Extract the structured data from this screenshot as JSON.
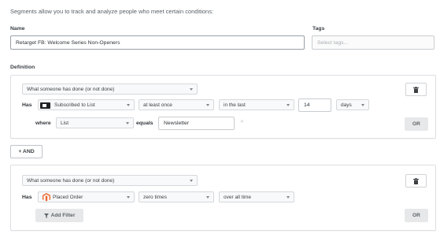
{
  "intro": "Segments allow you to track and analyze people who meet certain conditions:",
  "name": {
    "label": "Name",
    "value": "Retarget FB: Welcome Series Non-Openers"
  },
  "tags": {
    "label": "Tags",
    "placeholder": "Select tags..."
  },
  "definition": {
    "label": "Definition",
    "condition1": {
      "type": "What someone has done (or not done)",
      "has_label": "Has",
      "metric": "Subscribed to List",
      "metric_icon": "list-icon",
      "frequency": "at least once",
      "timeframe": "in the last",
      "amount": "14",
      "unit": "days",
      "where_label": "where",
      "filter_property": "List",
      "equals_label": "equals",
      "filter_value": "Newsletter",
      "or_label": "OR"
    },
    "and_label": "+ AND",
    "condition2": {
      "type": "What someone has done (or not done)",
      "has_label": "Has",
      "metric": "Placed Order",
      "metric_icon": "magento-icon",
      "frequency": "zero times",
      "timeframe": "over all time",
      "add_filter_label": "Add Filter",
      "or_label": "OR"
    }
  }
}
